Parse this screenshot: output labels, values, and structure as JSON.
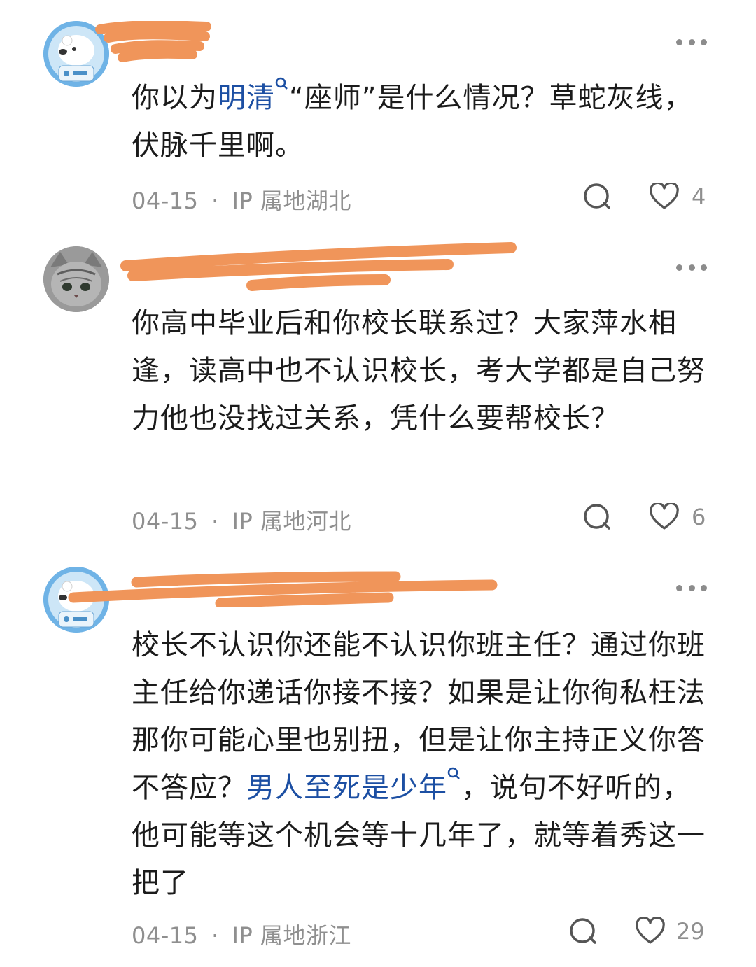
{
  "comments": [
    {
      "avatar": "polar-bear-astronaut-avatar",
      "text_before": "你以为",
      "link": "明清",
      "text_after": "“座师”是什么情况？草蛇灰线，伏脉千里啊。",
      "date": "04-15",
      "ip": "IP 属地湖北",
      "likes": "4"
    },
    {
      "avatar": "grey-cat-avatar",
      "text": "你高中毕业后和你校长联系过？大家萍水相逢，读高中也不认识校长，考大学都是自己努力他也没找过关系，凭什么要帮校长？",
      "date": "04-15",
      "ip": "IP 属地河北",
      "likes": "6"
    },
    {
      "avatar": "polar-bear-astronaut-avatar",
      "text_before": "校长不认识你还能不认识你班主任？通过你班主任给你递话你接不接？如果是让你徇私枉法那你可能心里也别扭，但是让你主持正义你答不答应？",
      "link": "男人至死是少年",
      "text_after": "，说句不好听的，他可能等这个机会等十几年了，就等着秀这一把了",
      "date": "04-15",
      "ip": "IP 属地浙江",
      "likes": "29"
    }
  ],
  "separator": "·",
  "colors": {
    "link": "#1c4fa3",
    "meta": "#8f8f8f",
    "redaction": "#f0955a",
    "avatar_bg": "#6fb3e6"
  },
  "icons": [
    "more-options-icon",
    "reply-icon",
    "heart-icon",
    "search-mark-icon"
  ]
}
